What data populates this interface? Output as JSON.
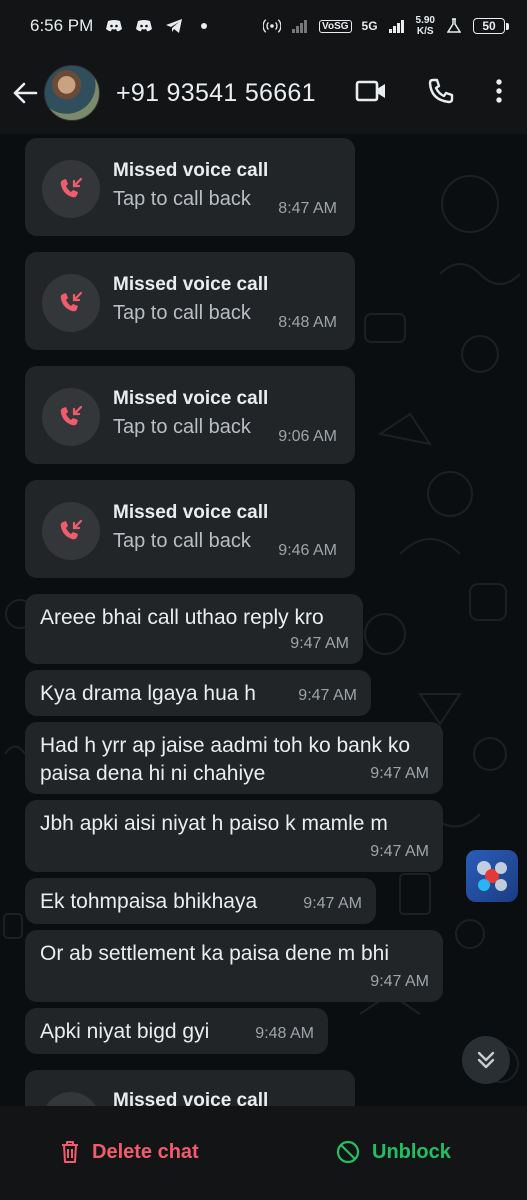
{
  "status_bar": {
    "time": "6:56 PM",
    "network_speed": "5.90\nK/S",
    "speed_value": "5.90",
    "speed_unit": "K/S",
    "network_type": "5G",
    "volte": "VoSG",
    "battery": "50"
  },
  "header": {
    "contact_name": "+91 93541 56661",
    "icons": [
      "back-arrow-icon",
      "video-call-icon",
      "voice-call-icon",
      "more-options-icon"
    ]
  },
  "calls": [
    {
      "title": "Missed voice call",
      "subtitle": "Tap to call back",
      "time": "8:47 AM"
    },
    {
      "title": "Missed voice call",
      "subtitle": "Tap to call back",
      "time": "8:48 AM"
    },
    {
      "title": "Missed voice call",
      "subtitle": "Tap to call back",
      "time": "9:06 AM"
    },
    {
      "title": "Missed voice call",
      "subtitle": "Tap to call back",
      "time": "9:46 AM"
    }
  ],
  "messages": [
    {
      "text": "Areee bhai call uthao reply kro",
      "time": "9:47 AM"
    },
    {
      "text": "Kya drama lgaya hua h",
      "time": "9:47 AM"
    },
    {
      "text": "Had h yrr ap jaise aadmi toh ko bank ko paisa dena hi ni chahiye",
      "time": "9:47 AM"
    },
    {
      "text": "Jbh apki aisi niyat h paiso k mamle m",
      "time": "9:47 AM"
    },
    {
      "text": "Ek tohmpaisa bhikhaya",
      "time": "9:47 AM"
    },
    {
      "text": "Or ab settlement ka paisa dene m bhi",
      "time": "9:47 AM"
    },
    {
      "text": "Apki niyat bigd gyi",
      "time": "9:48 AM"
    }
  ],
  "partial_call": {
    "title": "Missed voice call"
  },
  "bottom": {
    "delete_label": "Delete chat",
    "unblock_label": "Unblock"
  },
  "colors": {
    "missed_call_red": "#f15c6d",
    "unblock_green": "#21c063",
    "bubble": "#222527"
  }
}
